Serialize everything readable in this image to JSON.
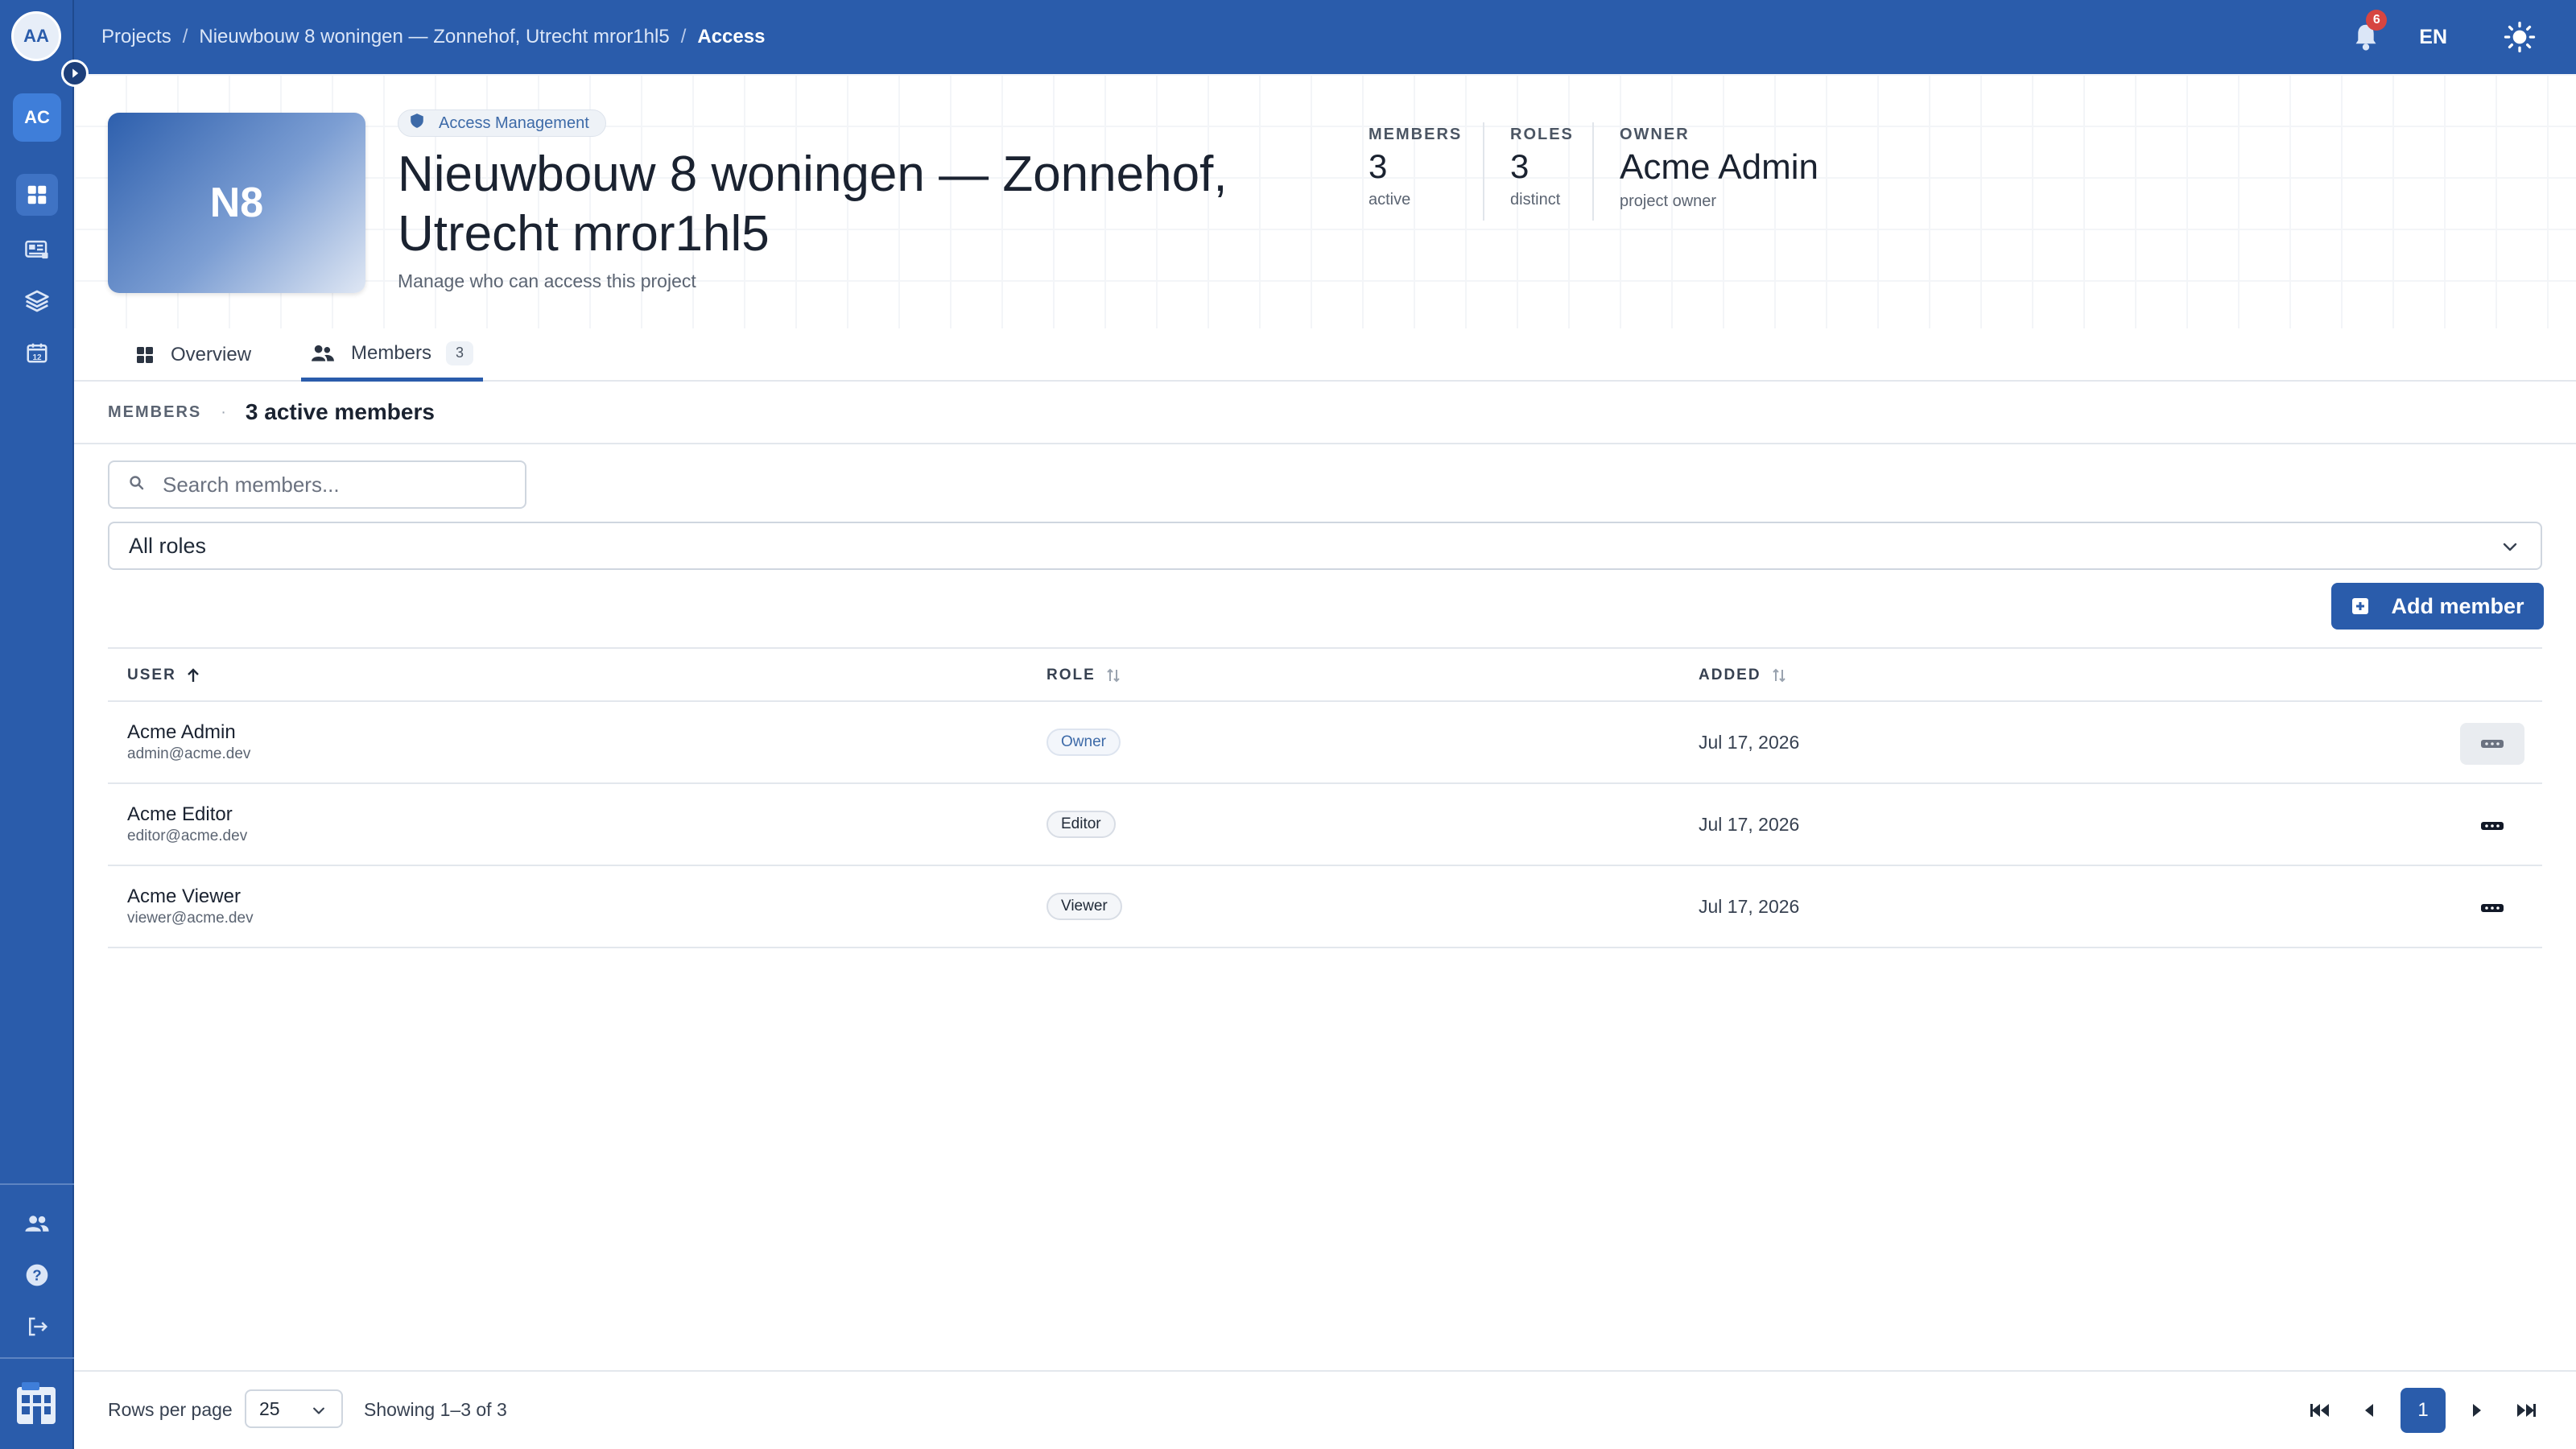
{
  "user": {
    "initials": "AA"
  },
  "org": {
    "initials": "AC"
  },
  "breadcrumb": [
    "Projects",
    "Nieuwbouw 8 woningen — Zonnehof, Utrecht mror1hl5",
    "Access"
  ],
  "topbar": {
    "notifications_count": "6",
    "language": "EN"
  },
  "sidebar": {
    "items": [
      {
        "icon": "dashboard-icon",
        "active": true
      },
      {
        "icon": "news-icon",
        "active": false
      },
      {
        "icon": "layers-icon",
        "active": false
      },
      {
        "icon": "calendar-icon",
        "active": false,
        "label": "12"
      }
    ],
    "bottom_items": [
      {
        "icon": "users-icon"
      },
      {
        "icon": "help-icon"
      },
      {
        "icon": "logout-icon"
      }
    ]
  },
  "project": {
    "thumb_initials": "N8",
    "chip": "Access Management",
    "title": "Nieuwbouw 8 woningen — Zonnehof, Utrecht mror1hl5",
    "subtitle": "Manage who can access this project"
  },
  "stats": [
    {
      "label": "MEMBERS",
      "value": "3",
      "sub": "active"
    },
    {
      "label": "ROLES",
      "value": "3",
      "sub": "distinct"
    },
    {
      "label": "OWNER",
      "value": "Acme Admin",
      "sub": "project owner"
    }
  ],
  "tabs": [
    {
      "label": "Overview",
      "icon": "grid-icon",
      "active": false
    },
    {
      "label": "Members",
      "icon": "people-icon",
      "active": true,
      "count": "3"
    }
  ],
  "section": {
    "label": "MEMBERS",
    "summary": "3 active members"
  },
  "search": {
    "placeholder": "Search members...",
    "value": ""
  },
  "role_filter": {
    "selected": "All roles"
  },
  "add_button": {
    "label": "Add member"
  },
  "table": {
    "columns": [
      {
        "label": "USER",
        "sort": "asc"
      },
      {
        "label": "ROLE",
        "sort": "none"
      },
      {
        "label": "ADDED",
        "sort": "none"
      }
    ],
    "rows": [
      {
        "name": "Acme Admin",
        "email": "admin@acme.dev",
        "role": "Owner",
        "added": "Jul 17, 2026"
      },
      {
        "name": "Acme Editor",
        "email": "editor@acme.dev",
        "role": "Editor",
        "added": "Jul 17, 2026"
      },
      {
        "name": "Acme Viewer",
        "email": "viewer@acme.dev",
        "role": "Viewer",
        "added": "Jul 17, 2026"
      }
    ]
  },
  "footer": {
    "rows_per_page_label": "Rows per page",
    "rows_per_page": "25",
    "showing": "Showing 1–3 of 3",
    "current_page": "1"
  },
  "colors": {
    "brand": "#2a5cab",
    "danger": "#d64541",
    "border": "#e3e7ed"
  }
}
